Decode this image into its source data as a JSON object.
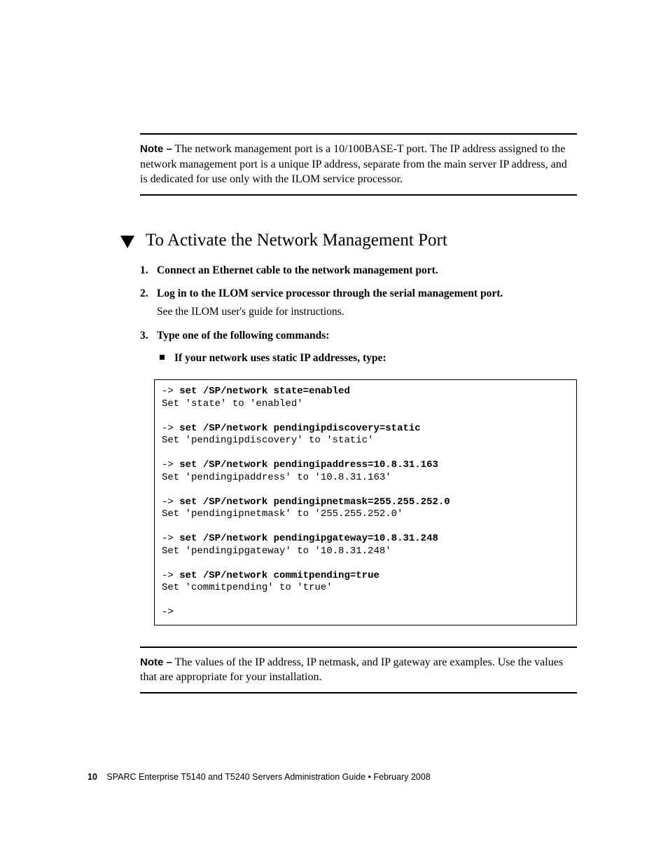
{
  "note1": {
    "label": "Note –",
    "text": " The network management port is a 10/100BASE-T port. The IP address assigned to the network management port is a unique IP address, separate from the main server IP address, and is dedicated for use only with the ILOM service processor."
  },
  "heading": "To Activate the Network Management Port",
  "steps": {
    "s1": {
      "title": "Connect an Ethernet cable to the network management port."
    },
    "s2": {
      "title": "Log in to the ILOM service processor through the serial management port.",
      "body": "See the ILOM user's guide for instructions."
    },
    "s3": {
      "title": "Type one of the following commands:",
      "bullet": "If your network uses static IP addresses, type:"
    }
  },
  "code": {
    "l1p": "-> ",
    "l1c": "set /SP/network state=enabled",
    "l2": "Set 'state' to 'enabled'",
    "l3p": "-> ",
    "l3c": "set /SP/network pendingipdiscovery=static",
    "l4": "Set 'pendingipdiscovery' to 'static'",
    "l5p": "-> ",
    "l5c": "set /SP/network pendingipaddress=10.8.31.163",
    "l6": "Set 'pendingipaddress' to '10.8.31.163'",
    "l7p": "-> ",
    "l7c": "set /SP/network pendingipnetmask=255.255.252.0",
    "l8": "Set 'pendingipnetmask' to '255.255.252.0'",
    "l9p": "-> ",
    "l9c": "set /SP/network pendingipgateway=10.8.31.248",
    "l10": "Set 'pendingipgateway' to '10.8.31.248'",
    "l11p": "-> ",
    "l11c": "set /SP/network commitpending=true",
    "l12": "Set 'commitpending' to 'true'",
    "l13": "->"
  },
  "note2": {
    "label": "Note –",
    "text": " The values of the IP address, IP netmask, and IP gateway are examples. Use the values that are appropriate for your installation."
  },
  "footer": {
    "page": "10",
    "title": "SPARC Enterprise T5140 and T5240 Servers Administration Guide • February 2008"
  }
}
